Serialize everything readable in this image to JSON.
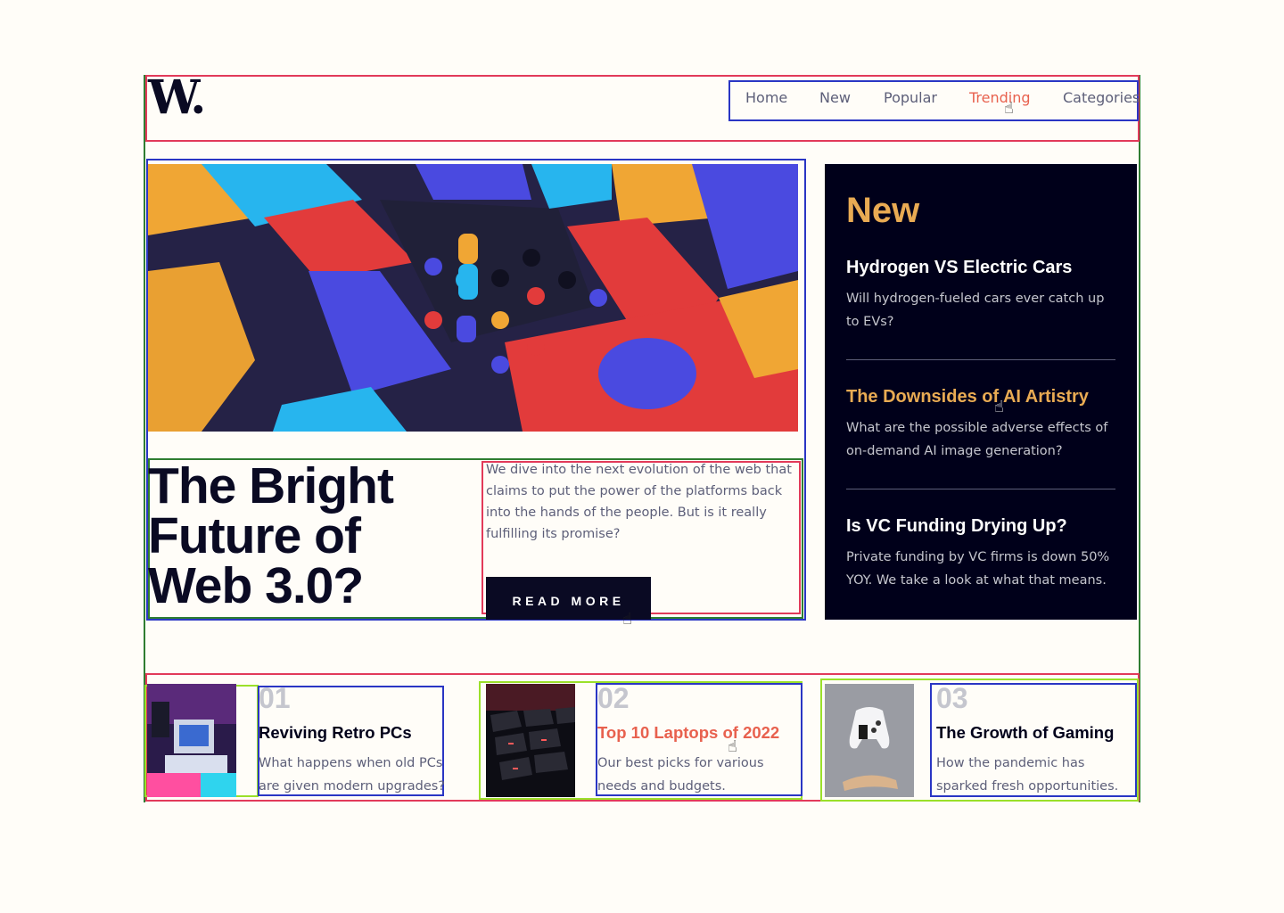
{
  "logo": {
    "text": "W."
  },
  "nav": {
    "items": [
      {
        "label": "Home"
      },
      {
        "label": "New"
      },
      {
        "label": "Popular"
      },
      {
        "label": "Trending",
        "active": true
      },
      {
        "label": "Categories"
      }
    ]
  },
  "hero": {
    "image_icon": "abstract-3d-blocks-image",
    "title": "The Bright Future of Web 3.0?",
    "description": "We dive into the next evolution of the web that claims to put the power of the platforms back into the hands of the people. But is it really fulfilling its promise?",
    "button_label": "READ MORE"
  },
  "new_panel": {
    "heading": "New",
    "items": [
      {
        "title": "Hydrogen VS Electric Cars",
        "description": "Will hydrogen-fueled cars ever catch up to EVs?"
      },
      {
        "title": "The Downsides of AI Artistry",
        "description": "What are the possible adverse effects of on-demand AI image generation?",
        "highlighted": true
      },
      {
        "title": "Is VC Funding Drying Up?",
        "description": "Private funding by VC firms is down 50% YOY. We take a look at what that means."
      }
    ]
  },
  "cards": [
    {
      "number": "01",
      "title": "Reviving Retro PCs",
      "description": "What happens when old PCs are given modern upgrades?",
      "image_icon": "retro-pc-image"
    },
    {
      "number": "02",
      "title": "Top 10 Laptops of 2022",
      "description": "Our best picks for various needs and budgets.",
      "image_icon": "laptop-keyboard-image",
      "highlighted": true
    },
    {
      "number": "03",
      "title": "The Growth of Gaming",
      "description": "How the pandemic has sparked fresh opportunities.",
      "image_icon": "gamepad-image"
    }
  ],
  "colors": {
    "background": "#fffdf8",
    "dark": "#00001a",
    "accent_orange": "#e9ab53",
    "accent_red": "#e8614e",
    "muted_text": "#5d5f79"
  }
}
